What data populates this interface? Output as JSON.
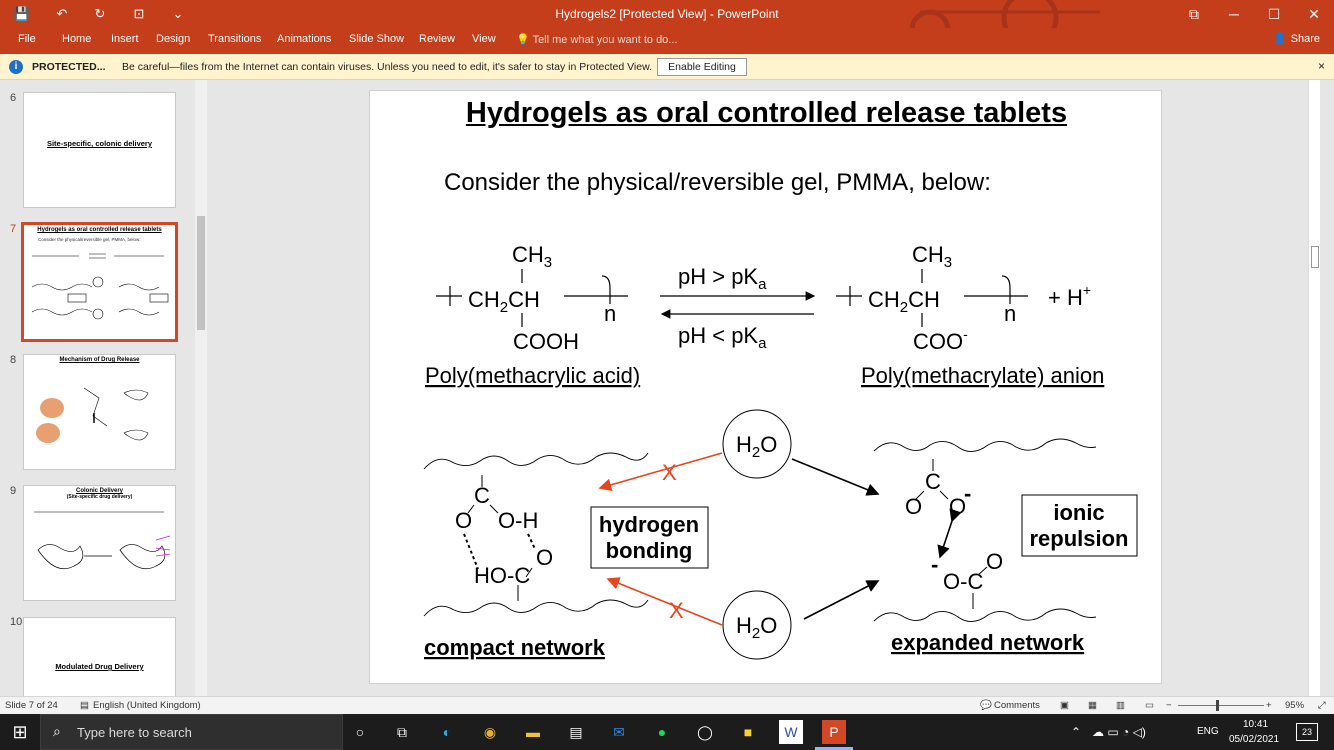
{
  "window": {
    "title": "Hydrogels2 [Protected View] - PowerPoint",
    "buttons": {
      "minimize": "─",
      "maximize": "☐",
      "close": "✕",
      "ribbon_display": "⧉"
    }
  },
  "quick_access": {
    "save": "💾",
    "undo": "↶",
    "redo": "↻",
    "present": "⊡",
    "customize": "⌄"
  },
  "ribbon": {
    "tabs": [
      "File",
      "Home",
      "Insert",
      "Design",
      "Transitions",
      "Animations",
      "Slide Show",
      "Review",
      "View"
    ],
    "tell_me": "Tell me what you want to do...",
    "share": "Share"
  },
  "protected_bar": {
    "label": "PROTECTED...",
    "message": "Be careful—files from the Internet can contain viruses. Unless you need to edit, it's safer to stay in Protected View.",
    "button": "Enable Editing",
    "close": "×"
  },
  "thumbnails": [
    {
      "number": "6",
      "title": "Site-specific, colonic delivery",
      "active": false
    },
    {
      "number": "7",
      "title": "Hydrogels as oral controlled release tablets",
      "subtitle": "Consider the physical/reversible gel, PMMA, below:",
      "active": true
    },
    {
      "number": "8",
      "title": "Mechanism of Drug Release",
      "active": false
    },
    {
      "number": "9",
      "title": "Colonic Delivery",
      "subtitle": "(Site-specific drug delivery)",
      "active": false
    },
    {
      "number": "10",
      "title": "Modulated Drug Delivery",
      "active": false
    }
  ],
  "slide": {
    "title": "Hydrogels as oral controlled release tablets",
    "subtitle": "Consider the physical/reversible gel, PMMA, below:",
    "left_group": {
      "top": "CH",
      "top_sub": "3",
      "main1": "CH",
      "main1_sub": "2",
      "main2": "CH",
      "bottom": "COOH",
      "n": "n",
      "name": "Poly(methacrylic acid)"
    },
    "right_group": {
      "top": "CH",
      "top_sub": "3",
      "main1": "CH",
      "main1_sub": "2",
      "main2": "CH",
      "bottom": "COO",
      "bottom_sup": "-",
      "n": "n",
      "name": "Poly(methacrylate) anion",
      "plus": "+  H",
      "plus_sup": "+"
    },
    "forward": {
      "text": "pH > pK",
      "sub": "a"
    },
    "backward": {
      "text": "pH < pK",
      "sub": "a"
    },
    "water": {
      "text": "H",
      "sub": "2",
      "tail": "O"
    },
    "cross": "X",
    "hbond_box": [
      "hydrogen",
      "bonding"
    ],
    "ionic_box": [
      "ionic",
      "repulsion"
    ],
    "compact_atoms": {
      "c_top": "C",
      "o_left": "O",
      "oh": "O-H",
      "o_right": "O",
      "hoc": "HO-C"
    },
    "expanded_atoms": {
      "c_top": "C",
      "o_left": "O",
      "o_right": "O",
      "minus": "-",
      "oc": "O-C",
      "o_bottom": "O"
    },
    "compact_label": "compact network",
    "expanded_label": "expanded network"
  },
  "status_bar": {
    "slide_info": "Slide 7 of 24",
    "language": "English (United Kingdom)",
    "comments": "Comments",
    "zoom": "95%"
  },
  "taskbar": {
    "search_placeholder": "Type here to search",
    "language": "ENG",
    "time": "10:41",
    "date": "05/02/2021",
    "notifications": "23"
  },
  "colors": {
    "accent": "#c43e1c",
    "protected_bg": "#fff4ce",
    "arrow_red": "#e8451f"
  }
}
